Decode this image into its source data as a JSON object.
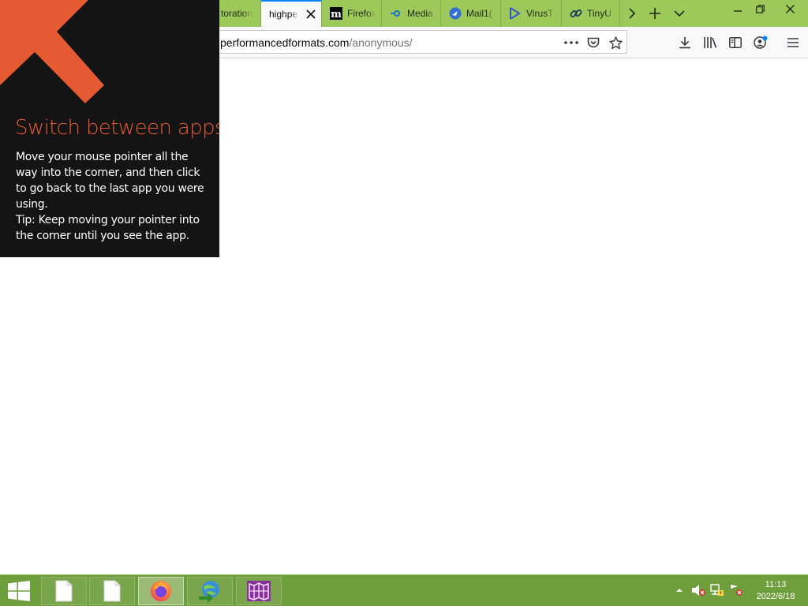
{
  "browser": {
    "tabs": [
      {
        "title": "toration",
        "icon": "restore-icon"
      },
      {
        "title": "highpe",
        "icon": "none",
        "active": true
      },
      {
        "title": "Firefox",
        "icon": "mozilla-m-icon"
      },
      {
        "title": "Media",
        "icon": "media-icon"
      },
      {
        "title": "Mail1(",
        "icon": "mail-icon"
      },
      {
        "title": "VirusT",
        "icon": "virustotal-icon"
      },
      {
        "title": "TinyU",
        "icon": "link-icon"
      }
    ],
    "url": {
      "domain": "performancedformats.com",
      "path": "/anonymous/"
    }
  },
  "hint": {
    "title": "Switch between apps",
    "body_lines": [
      "Move your mouse pointer all the way into the corner, and then click to go back to the last app you were using.",
      "Tip: Keep moving your pointer into the corner until you see the app."
    ]
  },
  "taskbar": {
    "items": [
      "file-icon",
      "file-icon",
      "firefox-icon",
      "download-manager-icon",
      "media-center-icon"
    ],
    "clock": {
      "time": "11:13",
      "date": "2022/6/18"
    }
  },
  "colors": {
    "tabbar": "#9dc85a",
    "active_tab_accent": "#0a84ff",
    "taskbar": "#6f9e3c",
    "hint_bg": "#141414",
    "hint_accent": "#e55a33"
  }
}
